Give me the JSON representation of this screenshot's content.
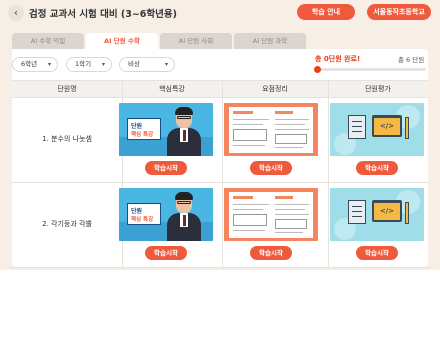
{
  "header": {
    "back_icon": "arrow-left-icon",
    "title": "검정 교과서 시험 대비 (3~6학년용)",
    "guide_label": "학습 안내",
    "school_label": "서울동작초등학교"
  },
  "tabs": [
    {
      "label": "AI 수학 익힘",
      "active": false
    },
    {
      "label": "AI 단원 수학",
      "active": true
    },
    {
      "label": "AI 단원 사회",
      "active": false
    },
    {
      "label": "AI 단원 과학",
      "active": false
    }
  ],
  "filters": {
    "grade": "6학년",
    "term": "1학기",
    "publisher": "비상"
  },
  "progress": {
    "label": "총 0단원 완료!",
    "total": "총 6 단원",
    "completed_units": 0,
    "total_units": 6
  },
  "table": {
    "columns": [
      "단원명",
      "핵심특강",
      "요점정리",
      "단원평가"
    ],
    "rows": [
      {
        "unit": "1. 분수의 나눗셈",
        "lecture_card_title": "단원",
        "lecture_card_sub": "핵심 특강",
        "buttons": [
          "학습시작",
          "학습시작",
          "학습시작"
        ]
      },
      {
        "unit": "2. 각기둥과 각뿔",
        "lecture_card_title": "단원",
        "lecture_card_sub": "핵심 특강",
        "buttons": [
          "학습시작",
          "학습시작",
          "학습시작"
        ]
      }
    ]
  },
  "colors": {
    "accent": "#f05a3c",
    "page_bg": "#f7efe6",
    "lecture_bg": "#49b6e4",
    "summary_bg": "#f5855f",
    "eval_bg": "#9fdde8"
  }
}
